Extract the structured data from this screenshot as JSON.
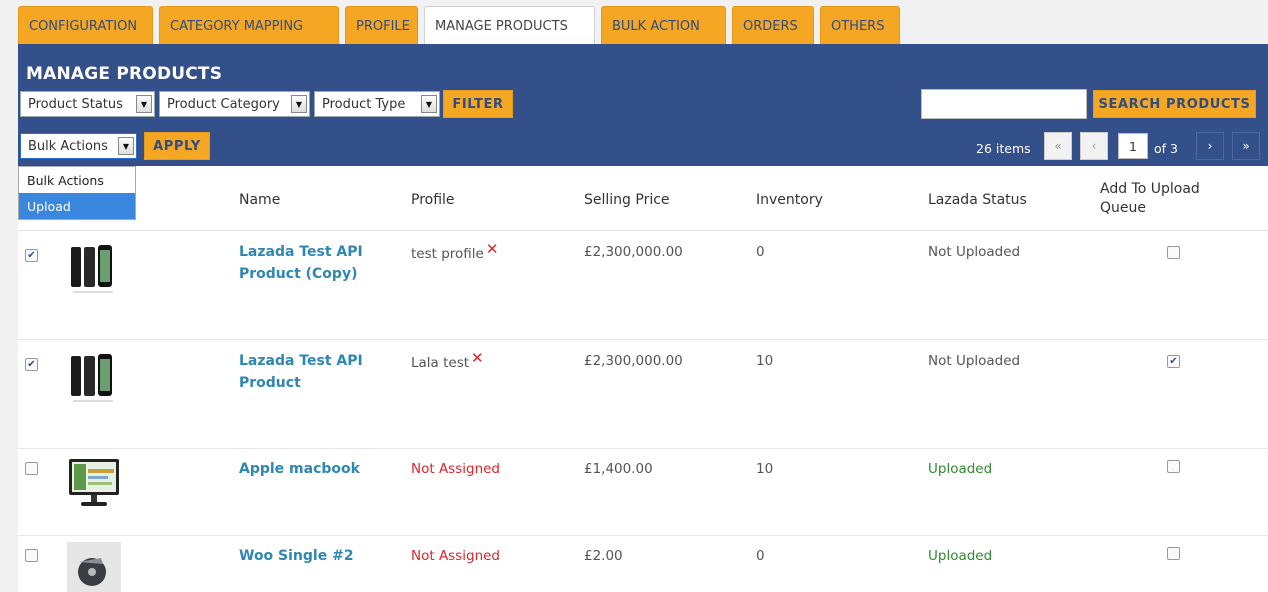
{
  "tabs": [
    {
      "label": "CONFIGURATION"
    },
    {
      "label": "CATEGORY MAPPING"
    },
    {
      "label": "PROFILE"
    },
    {
      "label": "MANAGE PRODUCTS"
    },
    {
      "label": "BULK ACTION"
    },
    {
      "label": "ORDERS"
    },
    {
      "label": "OTHERS"
    }
  ],
  "page": {
    "title": "MANAGE PRODUCTS"
  },
  "filters": {
    "product_status": "Product Status",
    "product_category": "Product Category",
    "product_type": "Product Type",
    "filter_label": "FILTER",
    "search_label": "SEARCH PRODUCTS",
    "search_value": ""
  },
  "bulk": {
    "selected": "Bulk Actions",
    "apply_label": "APPLY",
    "options": [
      "Bulk Actions",
      "Upload"
    ],
    "highlighted": "Upload"
  },
  "pagination": {
    "count": "26 items",
    "first": "«",
    "prev": "‹",
    "current": "1",
    "of": "of 3",
    "next": "›",
    "last": "»"
  },
  "table": {
    "headers": {
      "name": "Name",
      "profile": "Profile",
      "price": "Selling Price",
      "inventory": "Inventory",
      "status": "Lazada Status",
      "queue": "Add To Upload Queue"
    },
    "rows": [
      {
        "checked": true,
        "name": "Lazada Test API Product (Copy)",
        "profile": "test profile",
        "profile_assigned": true,
        "price": "£2,300,000.00",
        "inventory": "0",
        "status": "Not Uploaded",
        "uploaded": false,
        "queue": false,
        "image": "phone"
      },
      {
        "checked": true,
        "name": "Lazada Test API Product",
        "profile": "Lala test",
        "profile_assigned": true,
        "price": "£2,300,000.00",
        "inventory": "10",
        "status": "Not Uploaded",
        "uploaded": false,
        "queue": true,
        "image": "phone"
      },
      {
        "checked": false,
        "name": "Apple macbook",
        "profile": "Not Assigned",
        "profile_assigned": false,
        "price": "£1,400.00",
        "inventory": "10",
        "status": "Uploaded",
        "uploaded": true,
        "queue": false,
        "image": "monitor"
      },
      {
        "checked": false,
        "name": "Woo Single #2",
        "profile": "Not Assigned",
        "profile_assigned": false,
        "price": "£2.00",
        "inventory": "0",
        "status": "Uploaded",
        "uploaded": true,
        "queue": false,
        "image": "disc"
      }
    ]
  },
  "icons": {
    "remove_profile": "close-icon",
    "dropdown": "caret-down-icon"
  },
  "colors": {
    "accent": "#f5a623",
    "header_bar": "#34508a",
    "link": "#2e87b3",
    "error": "#d9272c",
    "success": "#2e8b2e"
  }
}
